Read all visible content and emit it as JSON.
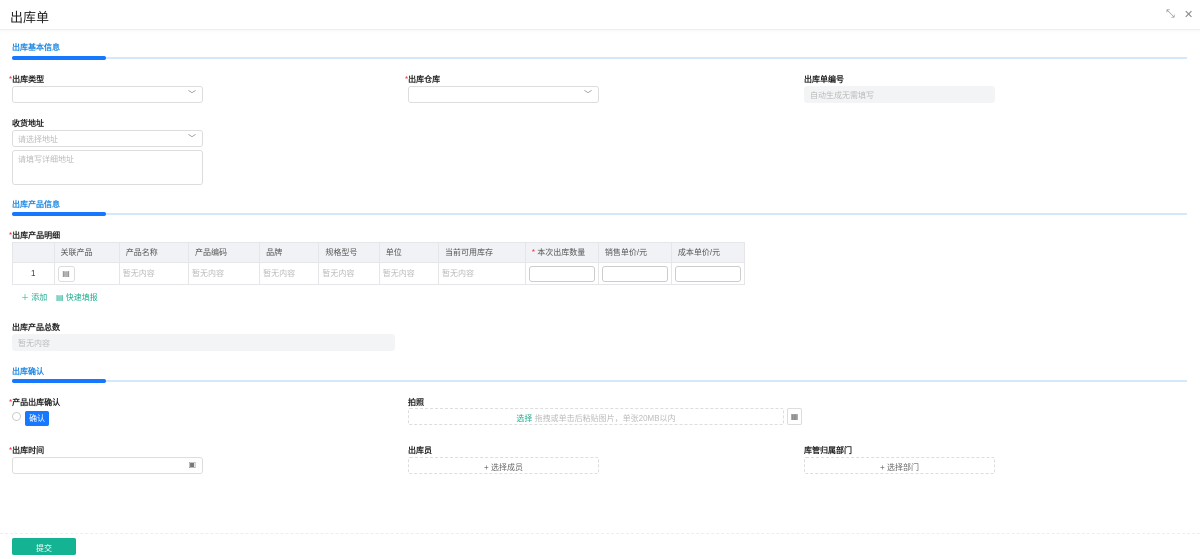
{
  "header": {
    "title": "出库单",
    "minimize_icon": "shrink-icon",
    "close_icon": "close-icon"
  },
  "sections": {
    "basic": "出库基本信息",
    "products": "出库产品信息",
    "confirm": "出库确认"
  },
  "basic": {
    "type_label": "出库类型",
    "warehouse_label": "出库仓库",
    "number_label": "出库单编号",
    "number_placeholder": "自动生成无需填写",
    "address_label": "收货地址",
    "address_placeholder": "请选择地址",
    "address_detail_placeholder": "请填写详细地址"
  },
  "products": {
    "detail_label": "出库产品明细",
    "columns": [
      "",
      "关联产品",
      "产品名称",
      "产品编码",
      "品牌",
      "规格型号",
      "单位",
      "当前可用库存",
      "本次出库数量",
      "销售单价/元",
      "成本单价/元"
    ],
    "rows": [
      {
        "index": "1",
        "name": "暂无内容",
        "code": "暂无内容",
        "brand": "暂无内容",
        "spec": "暂无内容",
        "unit": "暂无内容",
        "stock": "暂无内容"
      }
    ],
    "add_label": "添加",
    "quick_fill_label": "快速填报",
    "total_label": "出库产品总数",
    "total_value": "暂无内容"
  },
  "confirm": {
    "product_confirm_label": "产品出库确认",
    "confirm_tag": "确认",
    "photo_label": "拍照",
    "photo_select": "选择",
    "photo_hint": "拖拽或单击后粘贴图片，单张20MB以内",
    "time_label": "出库时间",
    "operator_label": "出库员",
    "operator_button": "+ 选择成员",
    "dept_label": "库管归属部门",
    "dept_button": "+ 选择部门"
  },
  "footer": {
    "submit_label": "提交"
  },
  "colors": {
    "accent": "#1677ff",
    "submit": "#14b394"
  }
}
